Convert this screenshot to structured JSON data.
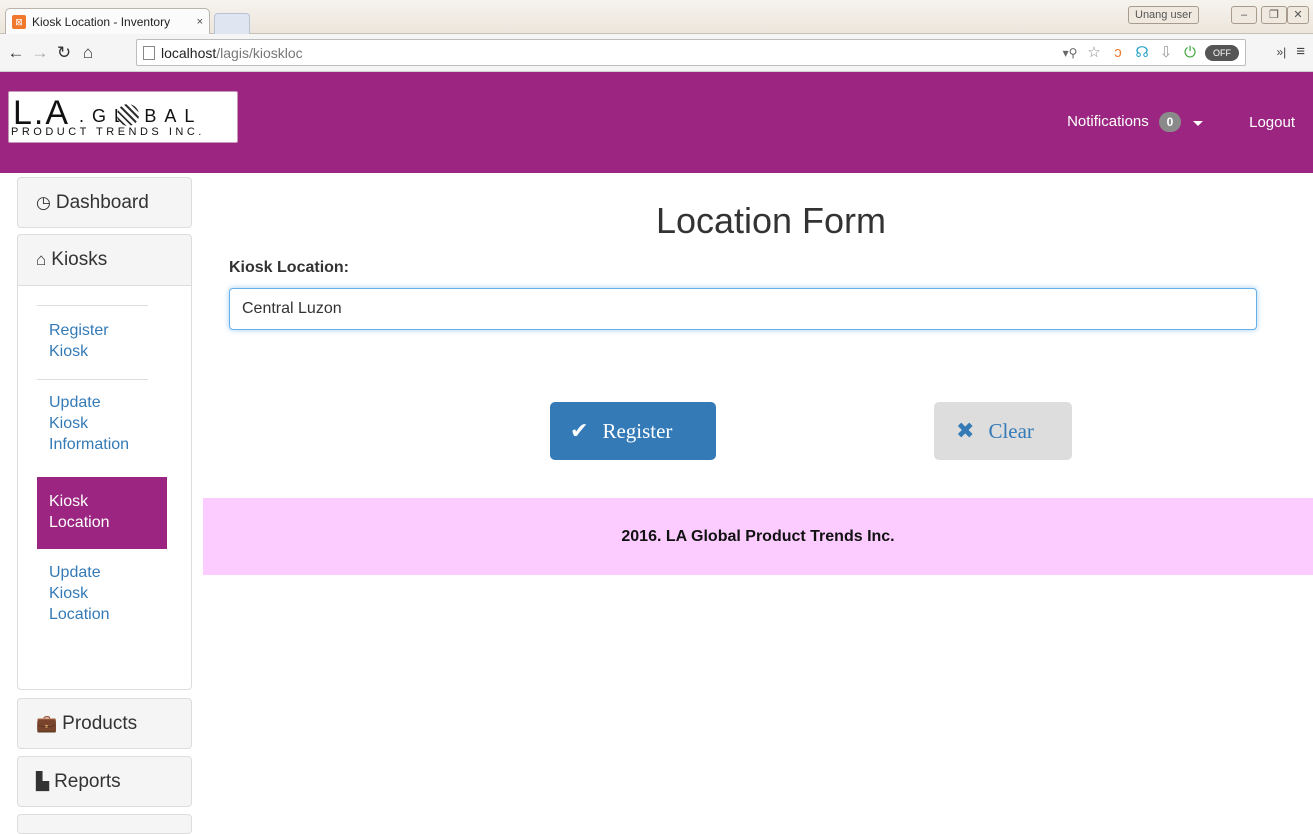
{
  "browser": {
    "tab_title": "Kiosk Location - Inventory",
    "tab_close": "×",
    "user_label": "Unang user",
    "url_host": "localhost",
    "url_path": "/lagis/kioskloc",
    "ext_off_label": "OFF"
  },
  "header": {
    "logo_big": "L.A",
    "logo_mid": ".GL  BAL",
    "logo_small": "PRODUCT TRENDS INC.",
    "notifications_label": "Notifications",
    "notifications_count": "0",
    "logout_label": "Logout"
  },
  "sidebar": {
    "dashboard_label": "Dashboard",
    "kiosks_label": "Kiosks",
    "kiosk_links": {
      "register_line1": "Register",
      "register_line2": "Kiosk",
      "update_info_line1": "Update",
      "update_info_line2": "Kiosk",
      "update_info_line3": "Information",
      "location_line1": "Kiosk",
      "location_line2": "Location",
      "update_loc_line1": "Update",
      "update_loc_line2": "Kiosk",
      "update_loc_line3": "Location"
    },
    "products_label": "Products",
    "reports_label": "Reports"
  },
  "main": {
    "title": "Location Form",
    "kiosk_location_label": "Kiosk Location:",
    "kiosk_location_value": "Central Luzon",
    "register_label": "Register",
    "clear_label": "Clear"
  },
  "footer": {
    "text": "2016. LA Global Product Trends Inc."
  },
  "colors": {
    "brand": "#9b2581",
    "primary_button": "#337ab7",
    "footer_bg": "#fccbff"
  }
}
